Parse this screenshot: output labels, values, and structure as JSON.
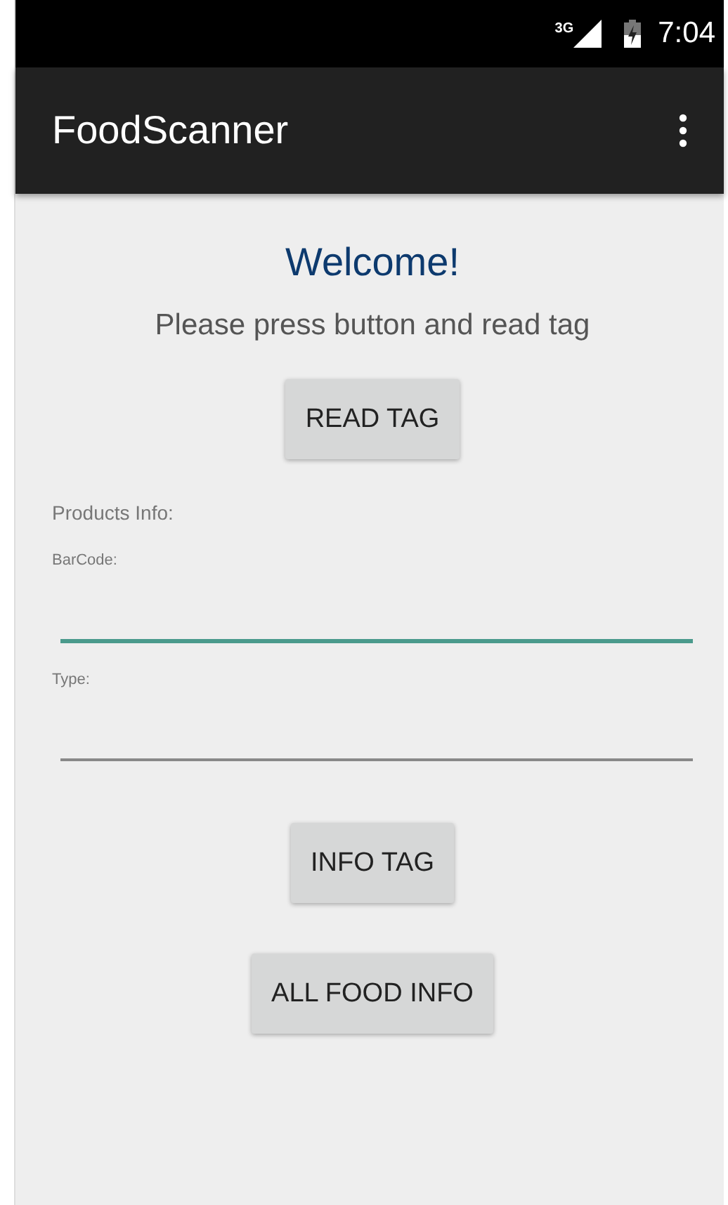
{
  "status_bar": {
    "network": "3G",
    "time": "7:04"
  },
  "app_bar": {
    "title": "FoodScanner"
  },
  "welcome": "Welcome!",
  "instruction": "Please press button and read tag",
  "read_button": "READ TAG",
  "section_label": "Products Info:",
  "fields": [
    {
      "label": "BarCode:",
      "focused": true
    },
    {
      "label": "Type:",
      "focused": false
    }
  ],
  "buttons": [
    "INFO TAG",
    "ALL FOOD INFO"
  ]
}
